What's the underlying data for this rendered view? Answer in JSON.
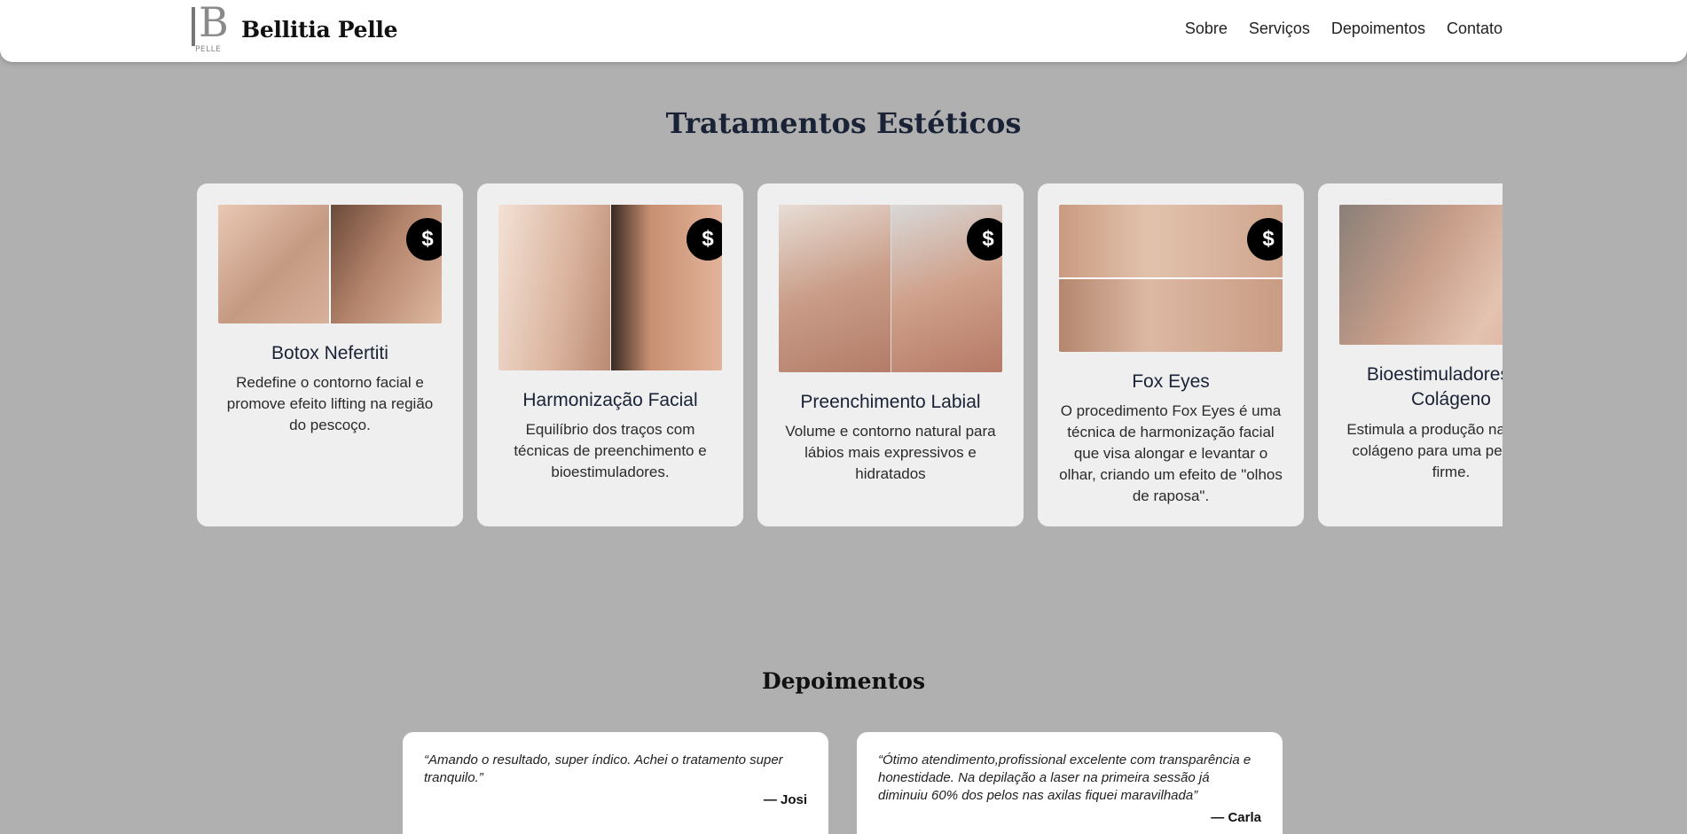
{
  "header": {
    "logo_letter": "B",
    "logo_small": "PELLE",
    "brand": "Bellitia Pelle",
    "nav": [
      {
        "label": "Sobre"
      },
      {
        "label": "Serviços"
      },
      {
        "label": "Depoimentos"
      },
      {
        "label": "Contato"
      }
    ]
  },
  "treatments": {
    "title": "Tratamentos Estéticos",
    "price_icon": "$",
    "cards": [
      {
        "title": "Botox Nefertiti",
        "text": "Redefine o contorno facial e promove efeito lifting na região do pescoço."
      },
      {
        "title": "Harmonização Facial",
        "text": "Equilíbrio dos traços com técnicas de preenchimento e bioestimuladores."
      },
      {
        "title": "Preenchimento Labial",
        "text": "Volume e contorno natural para lábios mais expressivos e hidratados"
      },
      {
        "title": "Fox Eyes",
        "text": "O procedimento Fox Eyes é uma técnica de harmonização facial que visa alongar e levantar o olhar, criando um efeito de \"olhos de raposa\"."
      },
      {
        "title": "Bioestimuladores de Colágeno",
        "text": "Estimula a produção natural de colágeno para uma pele mais firme."
      }
    ]
  },
  "testimonials": {
    "title": "Depoimentos",
    "items": [
      {
        "quote": "“Amando o resultado, super índico. Achei o tratamento super tranquilo.”",
        "author": "— Josi"
      },
      {
        "quote": "“Ótimo atendimento,profissional excelente com transparência e honestidade. Na depilação a laser na primeira sessão já diminuiu 60% dos pelos nas axilas fiquei maravilhada”",
        "author": "— Carla"
      }
    ]
  }
}
